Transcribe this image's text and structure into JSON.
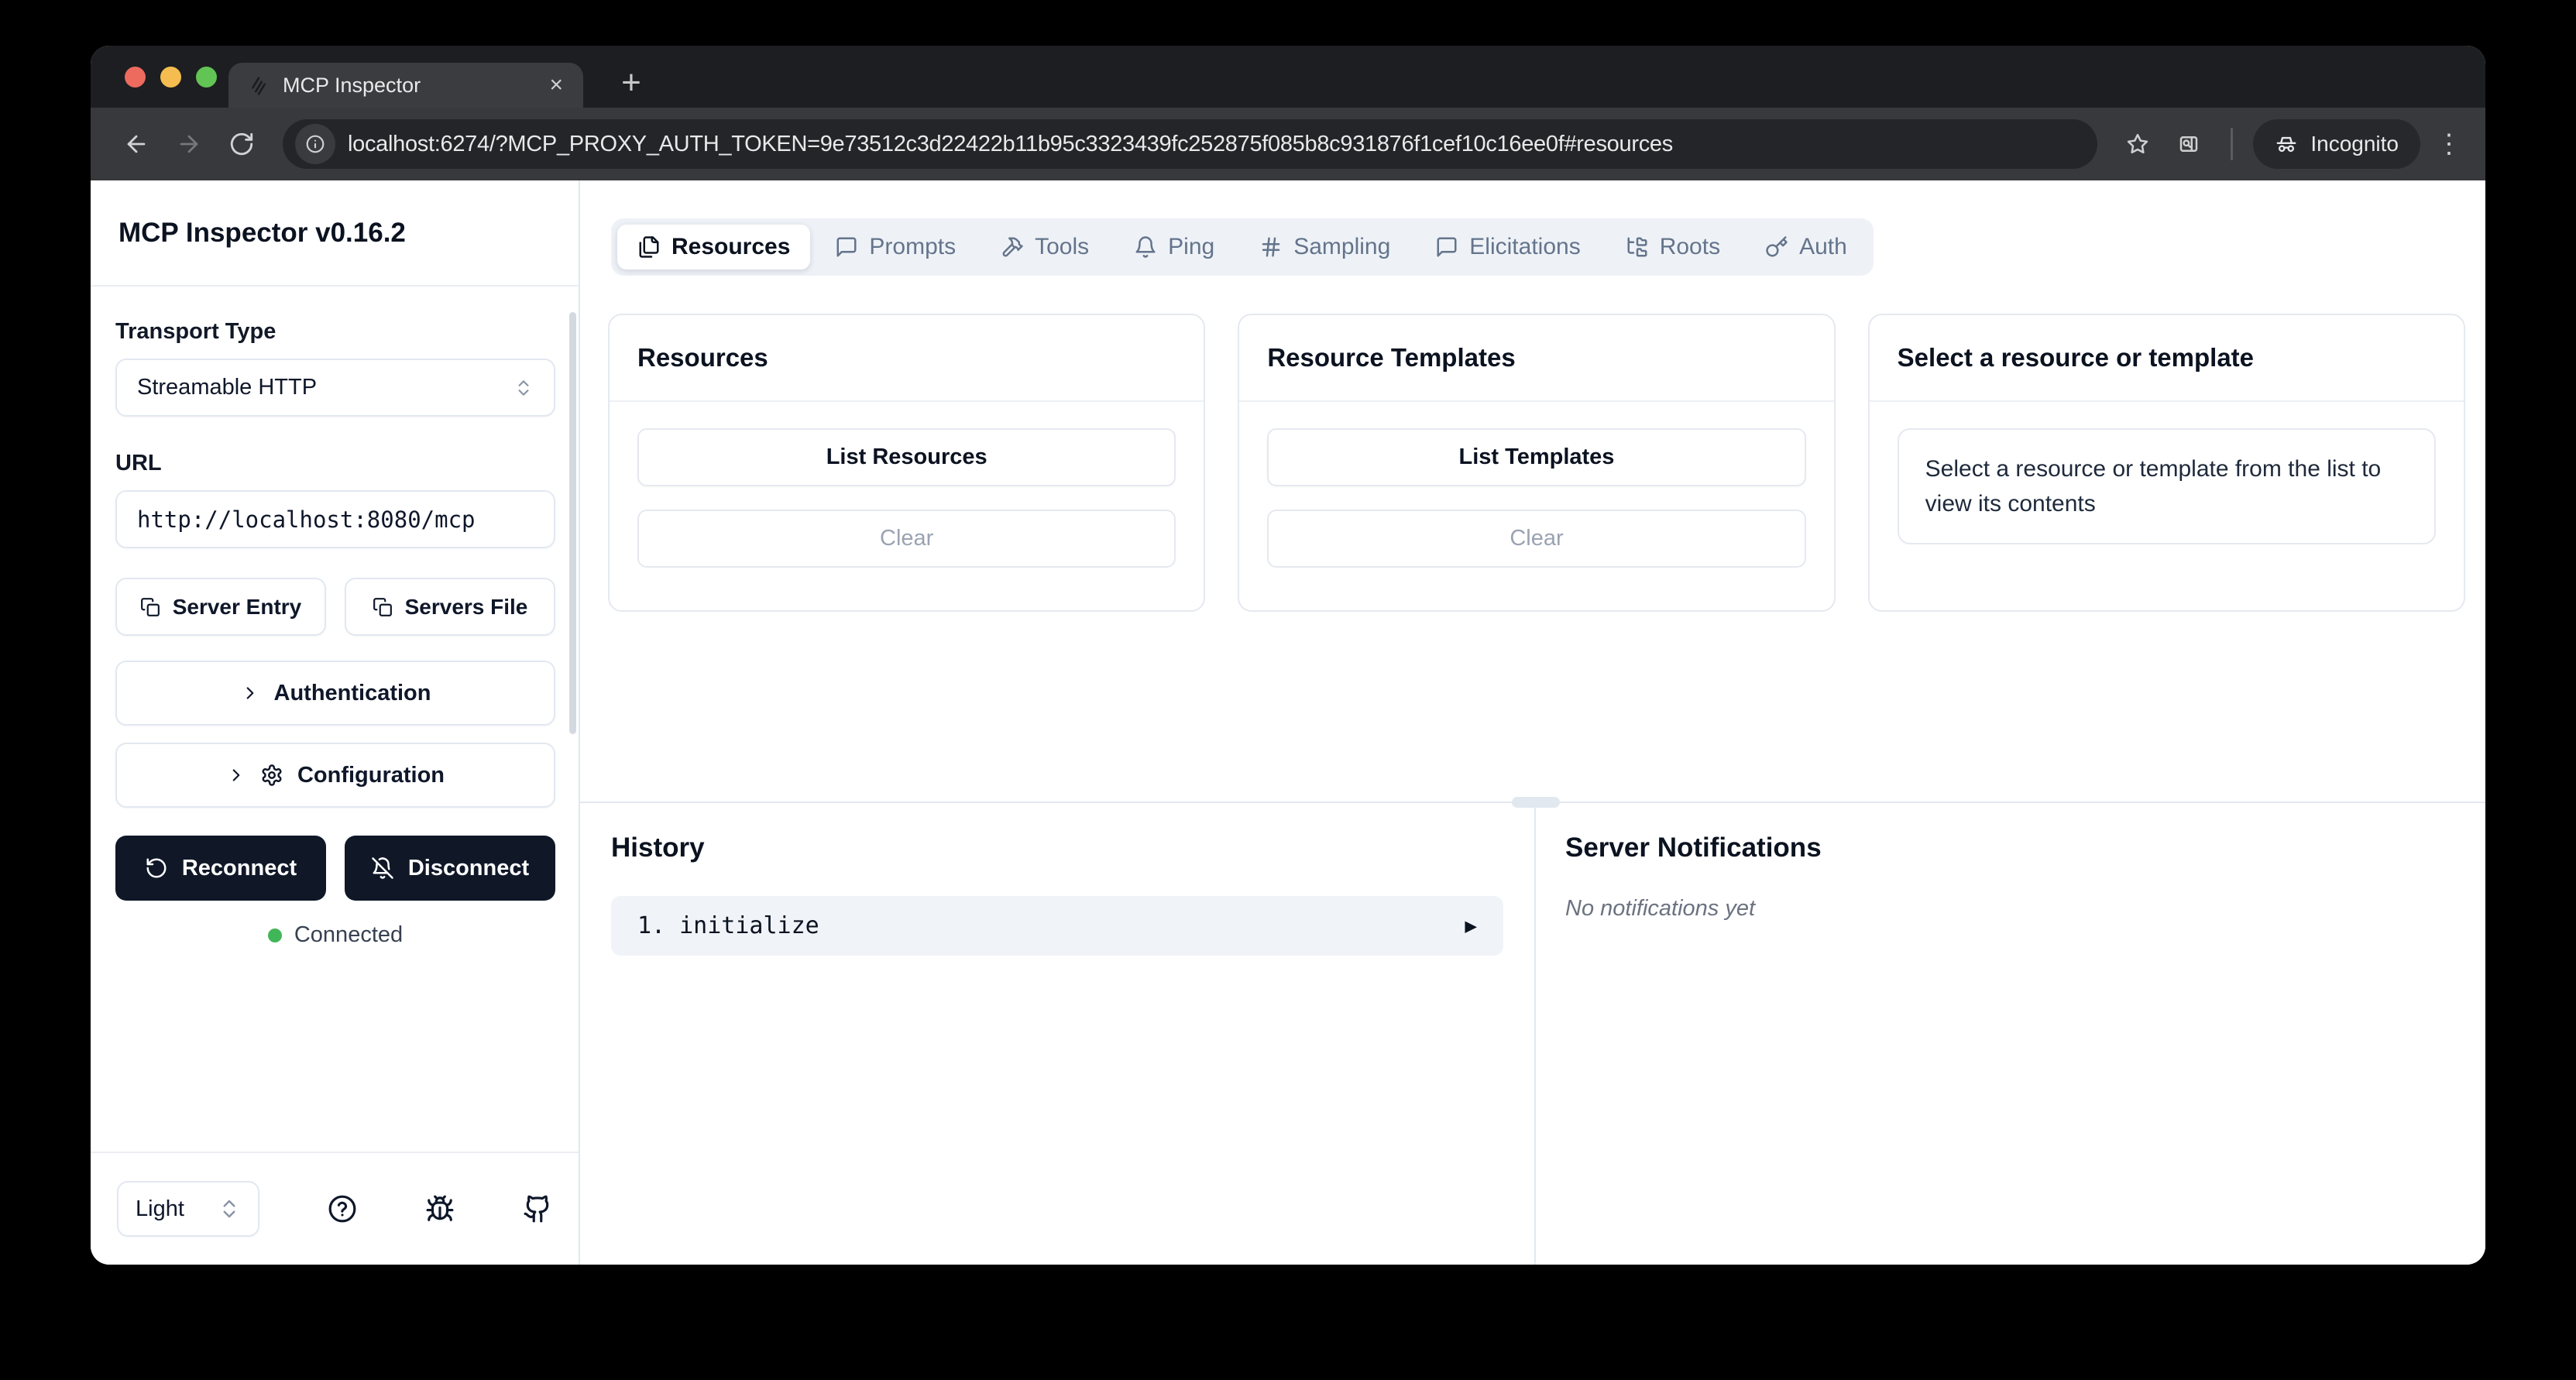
{
  "browser": {
    "tab_title": "MCP Inspector",
    "url": "localhost:6274/?MCP_PROXY_AUTH_TOKEN=9e73512c3d22422b11b95c3323439fc252875f085b8c931876f1cef10c16ee0f#resources",
    "incognito_label": "Incognito",
    "new_tab_glyph": "+",
    "close_tab_glyph": "×",
    "menu_glyph": "⋮"
  },
  "sidebar": {
    "title": "MCP Inspector v0.16.2",
    "transport": {
      "label": "Transport Type",
      "value": "Streamable HTTP"
    },
    "url_field": {
      "label": "URL",
      "value": "http://localhost:8080/mcp"
    },
    "server_entry_label": "Server Entry",
    "servers_file_label": "Servers File",
    "authentication_label": "Authentication",
    "configuration_label": "Configuration",
    "reconnect_label": "Reconnect",
    "disconnect_label": "Disconnect",
    "status_text": "Connected",
    "theme": {
      "value": "Light"
    }
  },
  "nav": {
    "tabs": [
      {
        "label": "Resources",
        "active": true
      },
      {
        "label": "Prompts"
      },
      {
        "label": "Tools"
      },
      {
        "label": "Ping"
      },
      {
        "label": "Sampling"
      },
      {
        "label": "Elicitations"
      },
      {
        "label": "Roots"
      },
      {
        "label": "Auth"
      }
    ]
  },
  "panels": {
    "resources": {
      "title": "Resources",
      "list_button": "List Resources",
      "clear_button": "Clear"
    },
    "templates": {
      "title": "Resource Templates",
      "list_button": "List Templates",
      "clear_button": "Clear"
    },
    "preview": {
      "title": "Select a resource or template",
      "placeholder": "Select a resource or template from the list to view its contents"
    }
  },
  "history": {
    "title": "History",
    "items": [
      {
        "number": "1.",
        "method": "initialize",
        "expander": "▶"
      }
    ]
  },
  "notifications": {
    "title": "Server Notifications",
    "empty_text": "No notifications yet"
  },
  "colors": {
    "status_green": "#41b658",
    "dark_button": "#101828",
    "accent_border": "#e2e8f0",
    "tabbar_bg": "#eef2f7",
    "history_row_bg": "#f0f4f8"
  }
}
